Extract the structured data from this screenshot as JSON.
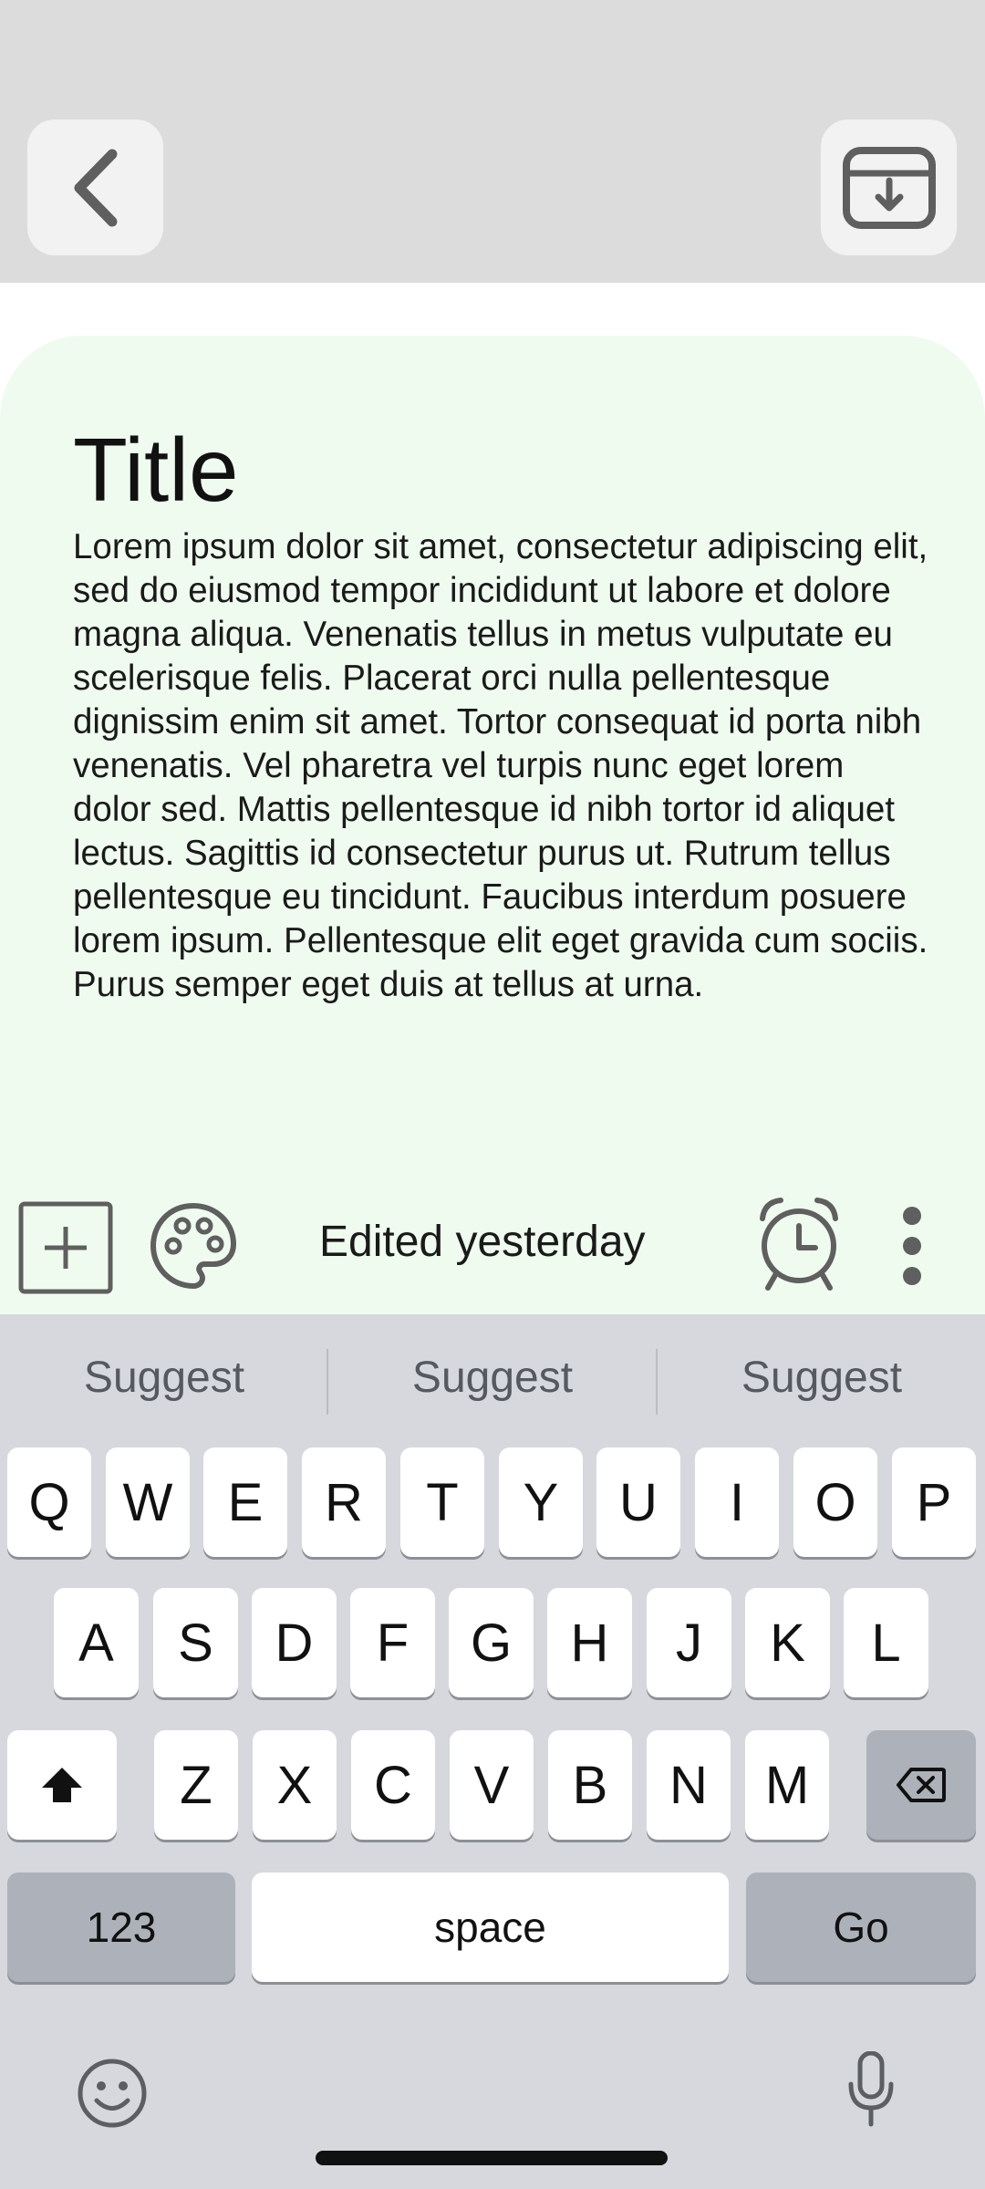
{
  "header": {
    "back_icon": "chevron-left-icon",
    "save_icon": "download-to-tray-icon"
  },
  "note": {
    "title": "Title",
    "body": "Lorem ipsum dolor sit amet, consectetur adipiscing elit, sed do eiusmod tempor incididunt ut labore et dolore magna aliqua. Venenatis tellus in metus vulputate eu scelerisque felis. Placerat orci nulla pellentesque dignissim enim sit amet. Tortor consequat id porta nibh venenatis. Vel pharetra vel turpis nunc eget lorem dolor sed. Mattis pellentesque id nibh tortor id aliquet lectus. Sagittis id consectetur purus ut. Rutrum tellus pellentesque eu tincidunt. Faucibus interdum posuere lorem ipsum. Pellentesque elit eget gravida cum sociis. Purus semper eget duis at tellus at urna.",
    "background_color": "#f0fbf0"
  },
  "toolbar": {
    "edited_label": "Edited yesterday",
    "icons": [
      "add-box-icon",
      "palette-icon",
      "alarm-clock-icon",
      "more-vertical-icon"
    ]
  },
  "keyboard": {
    "suggestions": [
      "Suggest",
      "Suggest",
      "Suggest"
    ],
    "row1": [
      "Q",
      "W",
      "E",
      "R",
      "T",
      "Y",
      "U",
      "I",
      "O",
      "P"
    ],
    "row2": [
      "A",
      "S",
      "D",
      "F",
      "G",
      "H",
      "J",
      "K",
      "L"
    ],
    "row3": [
      "Z",
      "X",
      "C",
      "V",
      "B",
      "N",
      "M"
    ],
    "numbers_label": "123",
    "space_label": "space",
    "go_label": "Go",
    "shift_icon": "shift-icon",
    "backspace_icon": "backspace-icon",
    "emoji_icon": "emoji-icon",
    "mic_icon": "microphone-icon"
  }
}
